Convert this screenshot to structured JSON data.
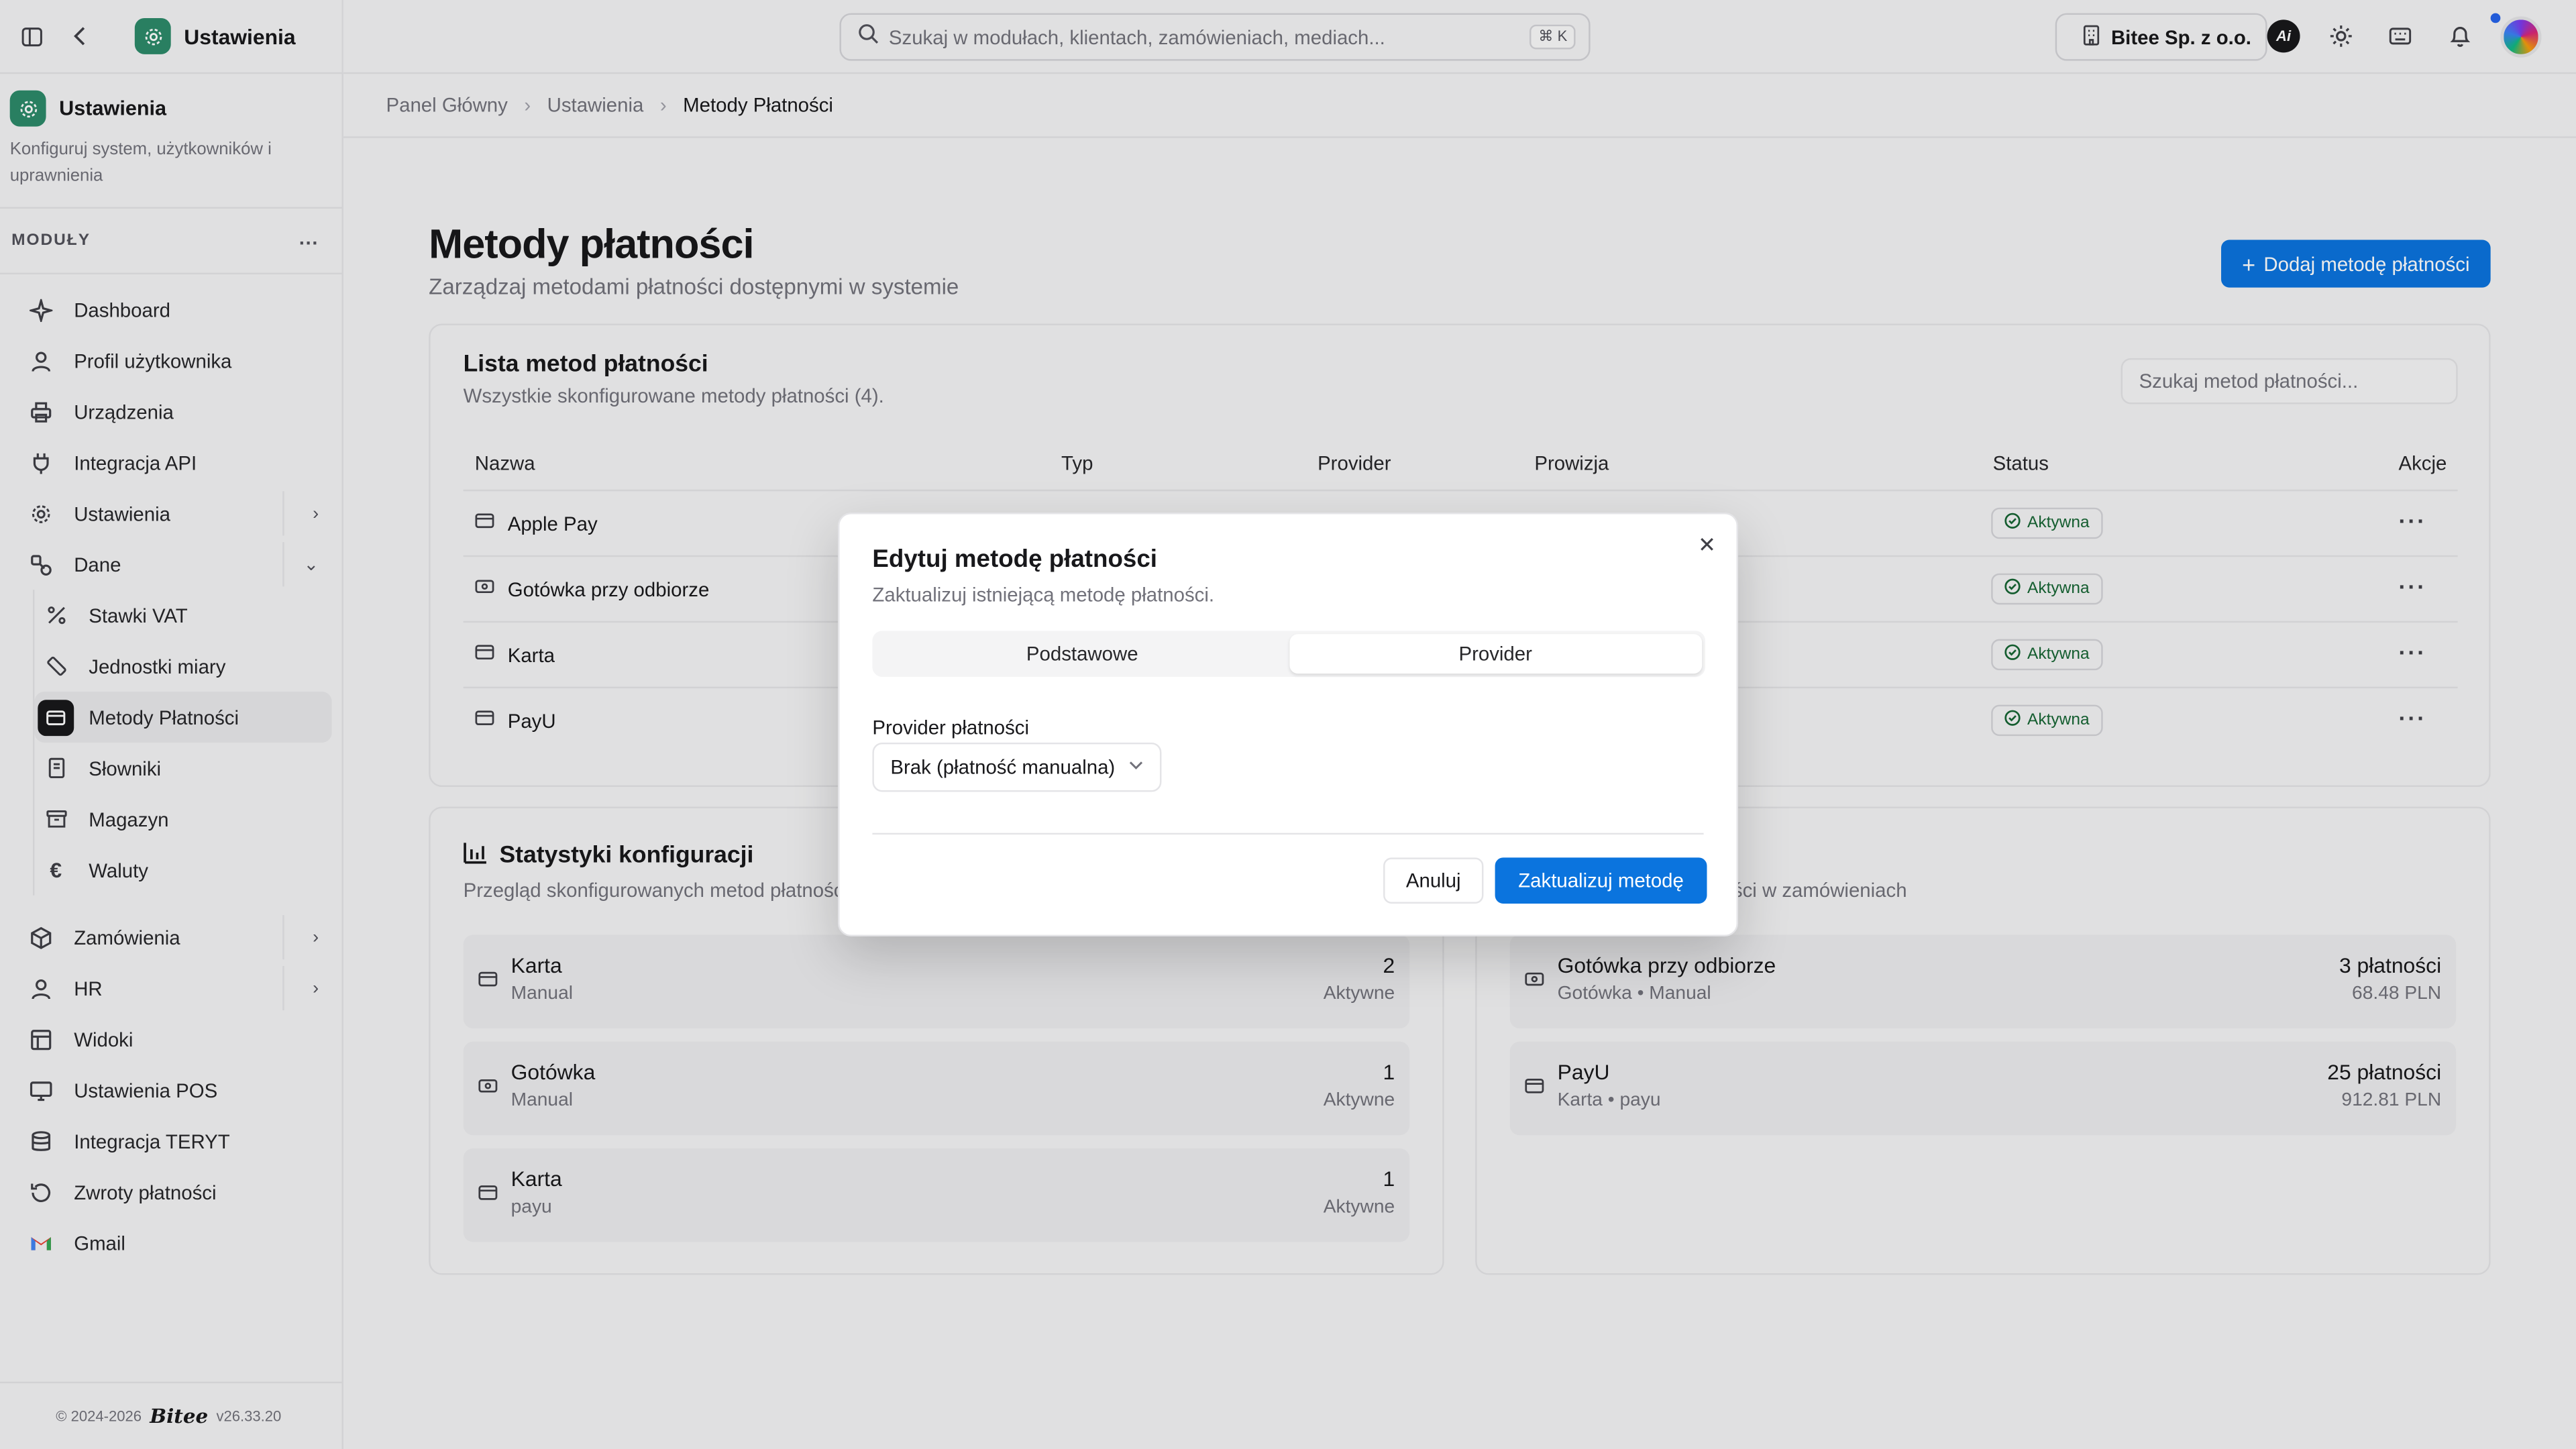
{
  "window": {
    "app_title": "Ustawienia"
  },
  "sidebar": {
    "header_title": "Ustawienia",
    "header_desc": "Konfiguruj system, użytkowników i uprawnienia",
    "modules_label": "MODUŁY",
    "items": [
      {
        "label": "Dashboard",
        "icon": "sparkle-icon"
      },
      {
        "label": "Profil użytkownika",
        "icon": "user-icon"
      },
      {
        "label": "Urządzenia",
        "icon": "printer-icon"
      },
      {
        "label": "Integracja API",
        "icon": "plug-icon"
      },
      {
        "label": "Ustawienia",
        "icon": "gear-icon"
      },
      {
        "label": "Dane",
        "icon": "shapes-icon"
      }
    ],
    "sub_items": [
      {
        "label": "Stawki VAT",
        "icon": "percent-icon"
      },
      {
        "label": "Jednostki miary",
        "icon": "ruler-icon"
      },
      {
        "label": "Metody Płatności",
        "icon": "credit-card-icon"
      },
      {
        "label": "Słowniki",
        "icon": "book-icon"
      },
      {
        "label": "Magazyn",
        "icon": "archive-icon"
      },
      {
        "label": "Waluty",
        "icon": "euro-icon"
      }
    ],
    "items_bottom": [
      {
        "label": "Zamówienia",
        "icon": "package-icon"
      },
      {
        "label": "HR",
        "icon": "user-icon"
      },
      {
        "label": "Widoki",
        "icon": "layout-icon"
      },
      {
        "label": "Ustawienia POS",
        "icon": "monitor-icon"
      },
      {
        "label": "Integracja TERYT",
        "icon": "database-icon"
      },
      {
        "label": "Zwroty płatności",
        "icon": "refresh-icon"
      },
      {
        "label": "Gmail",
        "icon": "gmail-icon"
      }
    ],
    "footer_copy": "© 2024-2026",
    "footer_brand": "Bitee",
    "footer_version": "v26.33.20"
  },
  "topbar": {
    "search_placeholder": "Szukaj w modułach, klientach, zamówieniach, mediach...",
    "search_shortcut": "⌘ K",
    "company": "Bitee Sp. z o.o.",
    "ai_label": "Ai"
  },
  "breadcrumb": [
    "Panel Główny",
    "Ustawienia",
    "Metody Płatności"
  ],
  "page": {
    "title": "Metody płatności",
    "subtitle": "Zarządzaj metodami płatności dostępnymi w systemie",
    "add_button": "Dodaj metodę płatności"
  },
  "list_card": {
    "title": "Lista metod płatności",
    "subtitle": "Wszystkie skonfigurowane metody płatności (4).",
    "search_placeholder": "Szukaj metod płatności...",
    "columns": [
      "Nazwa",
      "Typ",
      "Provider",
      "Prowizja",
      "Status",
      "Akcje"
    ],
    "rows": [
      {
        "name": "Apple Pay",
        "icon": "credit-card-icon",
        "status": "Aktywna"
      },
      {
        "name": "Gotówka przy odbiorze",
        "icon": "cash-icon",
        "status": "Aktywna"
      },
      {
        "name": "Karta",
        "icon": "credit-card-icon",
        "status": "Aktywna"
      },
      {
        "name": "PayU",
        "icon": "credit-card-icon",
        "status": "Aktywna"
      }
    ]
  },
  "stats_card": {
    "title": "Statystyki konfiguracji",
    "subtitle": "Przegląd skonfigurowanych metod płatności",
    "items": [
      {
        "name": "Karta",
        "sub": "Manual",
        "value": "2",
        "value_sub": "Aktywne",
        "icon": "credit-card-icon"
      },
      {
        "name": "Gotówka",
        "sub": "Manual",
        "value": "1",
        "value_sub": "Aktywne",
        "icon": "cash-icon"
      },
      {
        "name": "Karta",
        "sub": "payu",
        "value": "1",
        "value_sub": "Aktywne",
        "icon": "credit-card-icon"
      }
    ]
  },
  "usage_card": {
    "subtitle": "ości w zamówieniach",
    "items": [
      {
        "name": "Gotówka przy odbiorze",
        "sub": "Gotówka • Manual",
        "value": "3 płatności",
        "value_sub": "68.48 PLN",
        "icon": "cash-icon"
      },
      {
        "name": "PayU",
        "sub": "Karta • payu",
        "value": "25 płatności",
        "value_sub": "912.81 PLN",
        "icon": "credit-card-icon"
      }
    ]
  },
  "modal": {
    "title": "Edytuj metodę płatności",
    "subtitle": "Zaktualizuj istniejącą metodę płatności.",
    "tabs": [
      "Podstawowe",
      "Provider"
    ],
    "active_tab": "Provider",
    "field_label": "Provider płatności",
    "field_value": "Brak (płatność manualna)",
    "cancel": "Anuluj",
    "submit": "Zaktualizuj metodę"
  },
  "colors": {
    "accent": "#0b74de",
    "brand": "#2d8a6a",
    "status_active": "#166534"
  }
}
